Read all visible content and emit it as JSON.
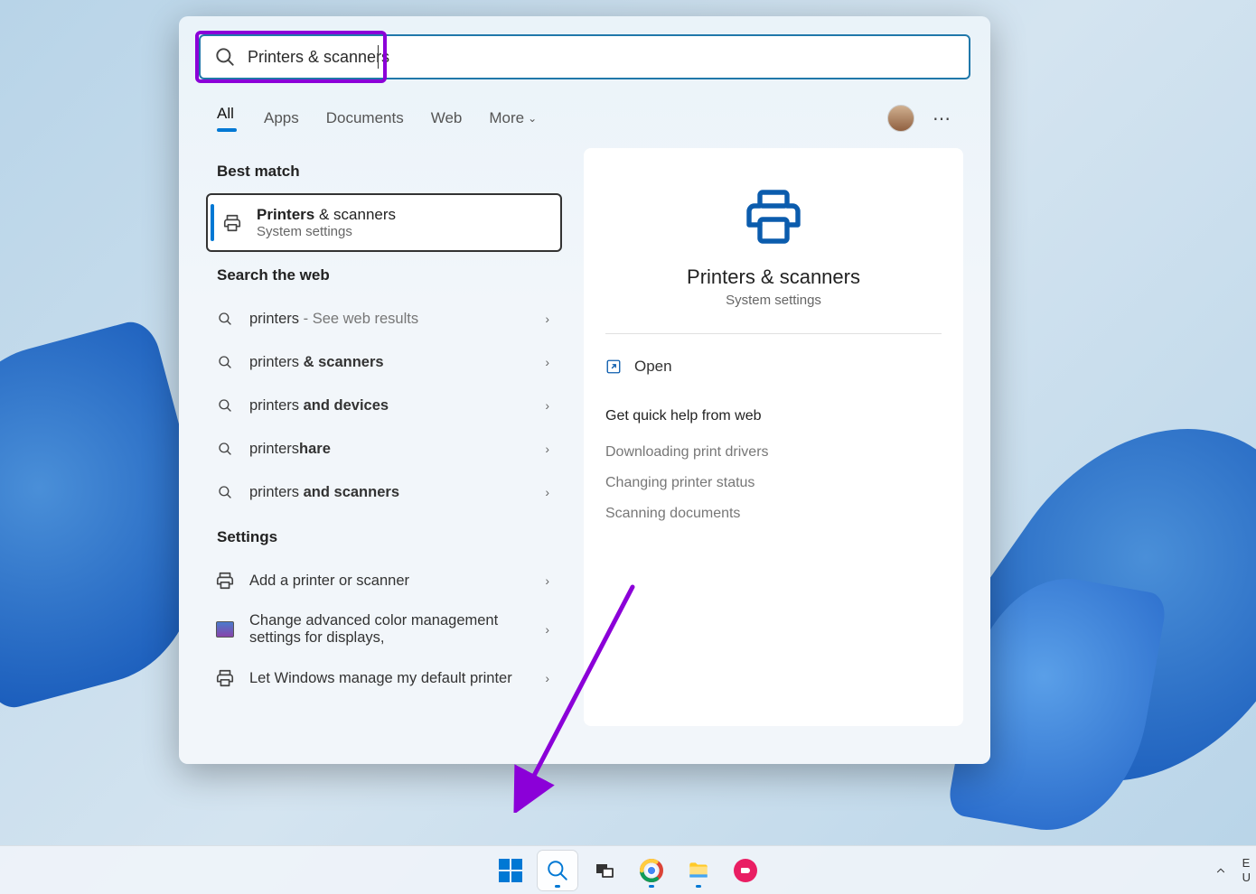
{
  "search": {
    "query": "Printers & scanners"
  },
  "tabs": {
    "all": "All",
    "apps": "Apps",
    "documents": "Documents",
    "web": "Web",
    "more": "More"
  },
  "sections": {
    "best_match": "Best match",
    "search_web": "Search the web",
    "settings": "Settings"
  },
  "best_match": {
    "title_bold": "Printers",
    "title_rest": " & scanners",
    "subtitle": "System settings"
  },
  "web_results": [
    {
      "prefix": "printers",
      "bold": "",
      "suffix": " - See web results",
      "dim_suffix": true
    },
    {
      "prefix": "printers ",
      "bold": "& scanners",
      "suffix": ""
    },
    {
      "prefix": "printers ",
      "bold": "and devices",
      "suffix": ""
    },
    {
      "prefix": "printers",
      "bold": "hare",
      "suffix": ""
    },
    {
      "prefix": "printers ",
      "bold": "and scanners",
      "suffix": ""
    }
  ],
  "settings_results": [
    {
      "label": "Add a printer or scanner",
      "icon": "printer"
    },
    {
      "label": "Change advanced color management settings for displays,",
      "icon": "display"
    },
    {
      "label": "Let Windows manage my default printer",
      "icon": "printer"
    }
  ],
  "preview": {
    "title": "Printers & scanners",
    "subtitle": "System settings",
    "open_label": "Open",
    "help_header": "Get quick help from web",
    "help_links": [
      "Downloading print drivers",
      "Changing printer status",
      "Scanning documents"
    ]
  },
  "taskbar": {
    "items": [
      "start",
      "search",
      "task-view",
      "chrome",
      "explorer",
      "app"
    ]
  }
}
